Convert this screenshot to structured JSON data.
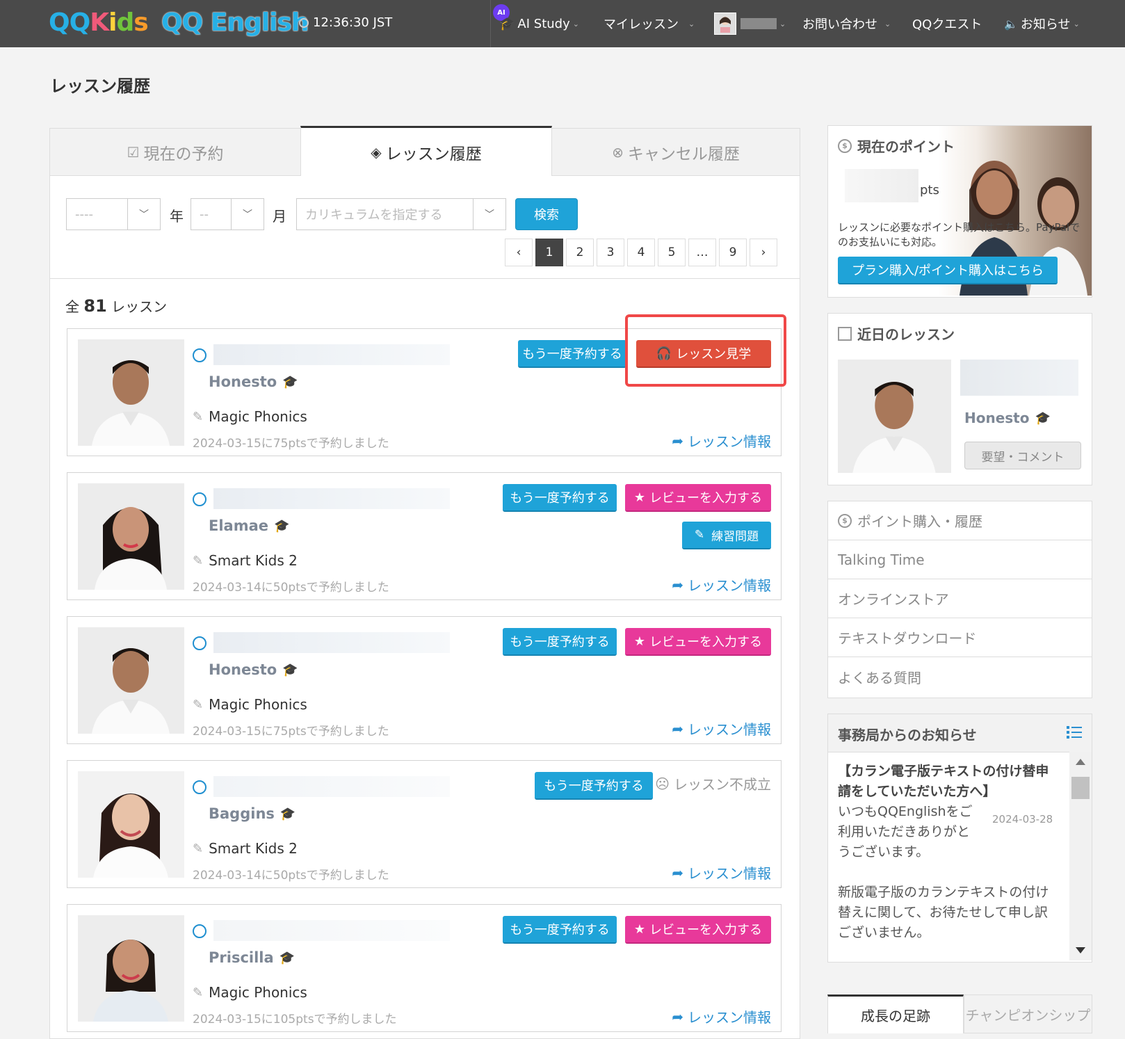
{
  "header": {
    "logo_kids": [
      "QQ",
      "K",
      "i",
      "d",
      "s"
    ],
    "logo_english": "QQ English",
    "clock": "12:36:30 JST",
    "ai_badge": "AI",
    "nav": [
      {
        "label": "AI Study"
      },
      {
        "label": "マイレッスン"
      },
      {
        "label": "お問い合わせ"
      },
      {
        "label": "QQクエスト"
      },
      {
        "label": "お知らせ"
      }
    ]
  },
  "page_title": "レッスン履歴",
  "tabs": [
    {
      "label": "現在の予約"
    },
    {
      "label": "レッスン履歴"
    },
    {
      "label": "キャンセル履歴"
    }
  ],
  "filters": {
    "year_value": "----",
    "year_label": "年",
    "month_value": "--",
    "month_label": "月",
    "curriculum_placeholder": "カリキュラムを指定する",
    "search_label": "検索"
  },
  "pagination": [
    "1",
    "2",
    "3",
    "4",
    "5",
    "…",
    "9"
  ],
  "total": {
    "prefix": "全",
    "count": "81",
    "suffix": "レッスン"
  },
  "lessons": [
    {
      "teacher": "Honesto",
      "course": "Magic Phonics",
      "booked": "2024-03-15に75ptsで予約しました",
      "rebook": "もう一度予約する",
      "action": "レッスン見学",
      "info": "レッスン情報"
    },
    {
      "teacher": "Elamae",
      "course": "Smart Kids 2",
      "booked": "2024-03-14に50ptsで予約しました",
      "rebook": "もう一度予約する",
      "action": "レビューを入力する",
      "exercise": "練習問題",
      "info": "レッスン情報"
    },
    {
      "teacher": "Honesto",
      "course": "Magic Phonics",
      "booked": "2024-03-15に75ptsで予約しました",
      "rebook": "もう一度予約する",
      "action": "レビューを入力する",
      "info": "レッスン情報"
    },
    {
      "teacher": "Baggins",
      "course": "Smart Kids 2",
      "booked": "2024-03-14に50ptsで予約しました",
      "rebook": "もう一度予約する",
      "status": "レッスン不成立",
      "info": "レッスン情報"
    },
    {
      "teacher": "Priscilla",
      "course": "Magic Phonics",
      "booked": "2024-03-15に105ptsで予約しました",
      "rebook": "もう一度予約する",
      "action": "レビューを入力する",
      "info": "レッスン情報"
    }
  ],
  "points": {
    "title": "現在のポイント",
    "unit": "pts",
    "text": "レッスンに必要なポイント購入はこちら。PayPalでのお支払いにも対応。",
    "button": "プラン購入/ポイント購入はこちら"
  },
  "upcoming": {
    "title": "近日のレッスン",
    "teacher": "Honesto",
    "button": "要望・コメント"
  },
  "menu": [
    {
      "label": "ポイント購入・履歴"
    },
    {
      "label": "Talking Time"
    },
    {
      "label": "オンラインストア"
    },
    {
      "label": "テキストダウンロード"
    },
    {
      "label": "よくある質問"
    }
  ],
  "news": {
    "title": "事務局からのお知らせ",
    "item_title": "【カラン電子版テキストの付け替申請をしていただいた方へ】",
    "item_date": "2024-03-28",
    "item_body1": "いつもQQEnglishをご利用いただきありがとうございます。",
    "item_body2": "新版電子版のカランテキストの付け替えに関して、お待たせして申し訳ございません。"
  },
  "bottom_tabs": [
    {
      "label": "成長の足跡"
    },
    {
      "label": "チャンピオンシップ"
    }
  ],
  "colors": {
    "primary_blue": "#1fa3d8",
    "review_pink": "#e8399a",
    "observe_red": "#e0503c",
    "highlight_red": "#f04848",
    "header_bg": "#4a4a4a"
  }
}
